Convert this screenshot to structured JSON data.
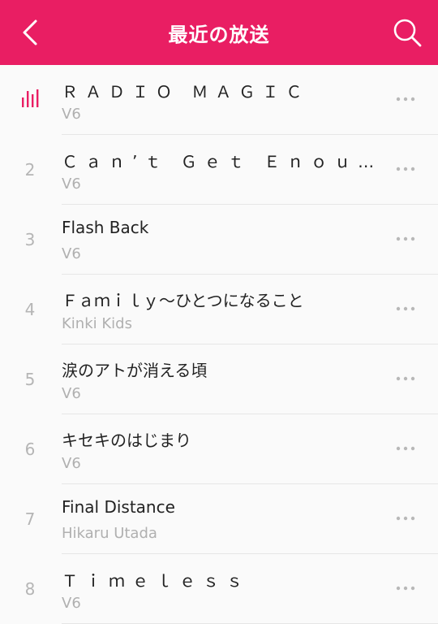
{
  "header": {
    "title": "最近の放送",
    "back_icon": "chevron-left-icon",
    "search_icon": "search-icon",
    "background_color": "#e91e63",
    "text_color": "#ffffff"
  },
  "tracks": [
    {
      "index": "",
      "playing": true,
      "title": "ＲＡＤＩＯ ＭＡＧＩＣ",
      "artist": "V6",
      "wide": true
    },
    {
      "index": "2",
      "playing": false,
      "title": "Ｃａｎ’ｔ Ｇｅｔ Ｅｎｏｕｇｈ（セ…",
      "artist": "V6",
      "wide": true
    },
    {
      "index": "3",
      "playing": false,
      "title": "Flash Back",
      "artist": "V6",
      "wide": false
    },
    {
      "index": "4",
      "playing": false,
      "title": "Ｆａｍｉｌｙ～ひとつになること",
      "artist": "Kinki Kids",
      "wide": false
    },
    {
      "index": "5",
      "playing": false,
      "title": "涙のアトが消える頃",
      "artist": "V6",
      "wide": false
    },
    {
      "index": "6",
      "playing": false,
      "title": "キセキのはじまり",
      "artist": "V6",
      "wide": false
    },
    {
      "index": "7",
      "playing": false,
      "title": "Final Distance",
      "artist": "Hikaru Utada",
      "wide": false
    },
    {
      "index": "8",
      "playing": false,
      "title": "Ｔｉｍｅｌｅｓｓ",
      "artist": "V6",
      "wide": true
    }
  ],
  "colors": {
    "accent": "#e91e63",
    "playing_indicator": "#e91e63",
    "index_text": "#b5b5b5",
    "artist_text": "#b0b0b0",
    "title_text": "#222222"
  },
  "icons": {
    "playing": "equalizer-icon",
    "more": "more-horizontal-icon"
  }
}
